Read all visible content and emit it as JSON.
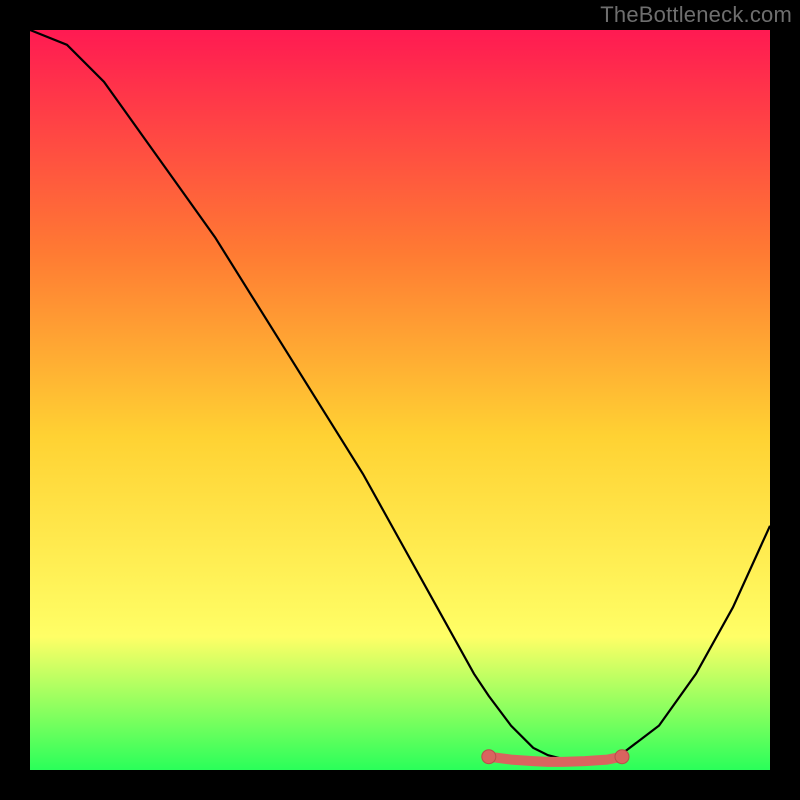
{
  "watermark": "TheBottleneck.com",
  "colors": {
    "bg_black": "#000000",
    "gradient_top": "#ff1a52",
    "gradient_mid1": "#ff7a33",
    "gradient_mid2": "#ffd233",
    "gradient_mid3": "#ffff66",
    "gradient_bottom": "#2aff5a",
    "curve": "#000000",
    "marker_fill": "#d9645f",
    "marker_stroke": "#b84f4a"
  },
  "chart_data": {
    "type": "line",
    "title": "",
    "xlabel": "",
    "ylabel": "",
    "xlim": [
      0,
      100
    ],
    "ylim": [
      0,
      100
    ],
    "series": [
      {
        "name": "bottleneck-curve",
        "x": [
          0,
          5,
          10,
          15,
          20,
          25,
          30,
          35,
          40,
          45,
          50,
          55,
          60,
          62,
          65,
          68,
          70,
          72,
          75,
          78,
          80,
          85,
          90,
          95,
          100
        ],
        "y": [
          100,
          98,
          93,
          86,
          79,
          72,
          64,
          56,
          48,
          40,
          31,
          22,
          13,
          10,
          6,
          3,
          2,
          1.5,
          1.2,
          1.5,
          2.2,
          6,
          13,
          22,
          33
        ]
      }
    ],
    "markers": {
      "name": "highlight-band",
      "x": [
        62,
        65,
        68,
        70,
        72,
        75,
        78,
        80
      ],
      "y": [
        1.8,
        1.4,
        1.2,
        1.1,
        1.1,
        1.2,
        1.4,
        1.8
      ]
    }
  }
}
